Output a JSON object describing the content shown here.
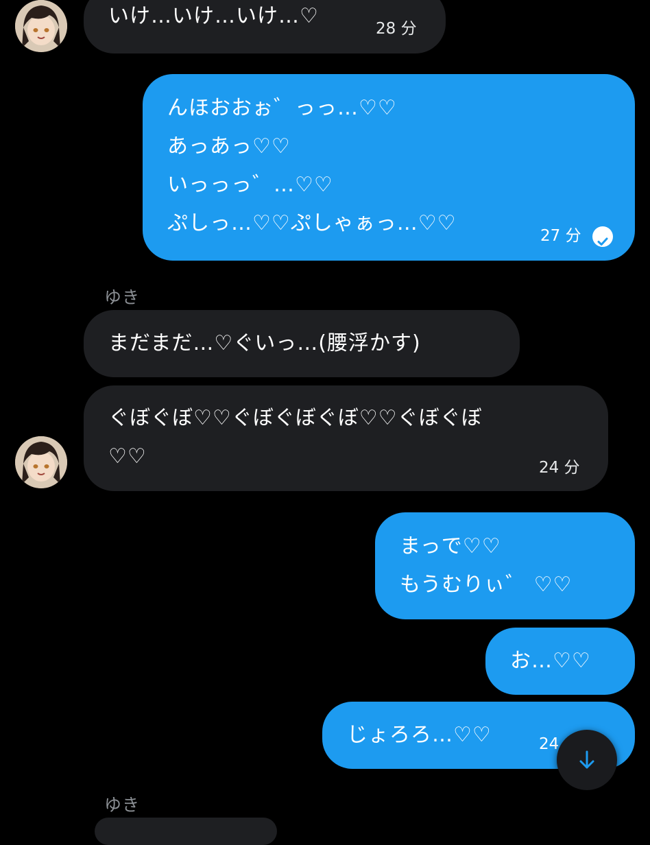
{
  "colors": {
    "background": "#000000",
    "received_bubble": "#1e1f22",
    "sent_bubble": "#1d9bf0",
    "sender_name": "#8b8f94"
  },
  "messages": [
    {
      "direction": "received",
      "lines": [
        "いけ…いけ…いけ…♡"
      ],
      "time": "28 分"
    },
    {
      "direction": "sent",
      "lines": [
        "んほおおぉ゛っっ…♡♡",
        "あっあっ♡♡",
        "いっっっ゛…♡♡",
        "ぷしっ…♡♡ぷしゃぁっ…♡♡"
      ],
      "time": "27 分",
      "read_icon": "check-circle-icon"
    },
    {
      "direction": "received",
      "sender": "ゆき",
      "lines": [
        "まだまだ…♡ぐいっ…(腰浮かす)"
      ]
    },
    {
      "direction": "received",
      "lines": [
        "ぐぼぐぼ♡♡ぐぼぐぼぐぼ♡♡ぐぼぐぼ",
        "♡♡"
      ],
      "time": "24 分"
    },
    {
      "direction": "sent",
      "lines": [
        "まっで♡♡",
        "もうむりぃ゛ ♡♡"
      ]
    },
    {
      "direction": "sent",
      "lines": [
        "お…♡♡"
      ]
    },
    {
      "direction": "sent",
      "lines": [
        "じょろろ…♡♡"
      ],
      "time": "24"
    },
    {
      "direction": "received",
      "sender": "ゆき",
      "lines": []
    }
  ],
  "scroll_button": {
    "icon": "arrow-down-icon"
  }
}
